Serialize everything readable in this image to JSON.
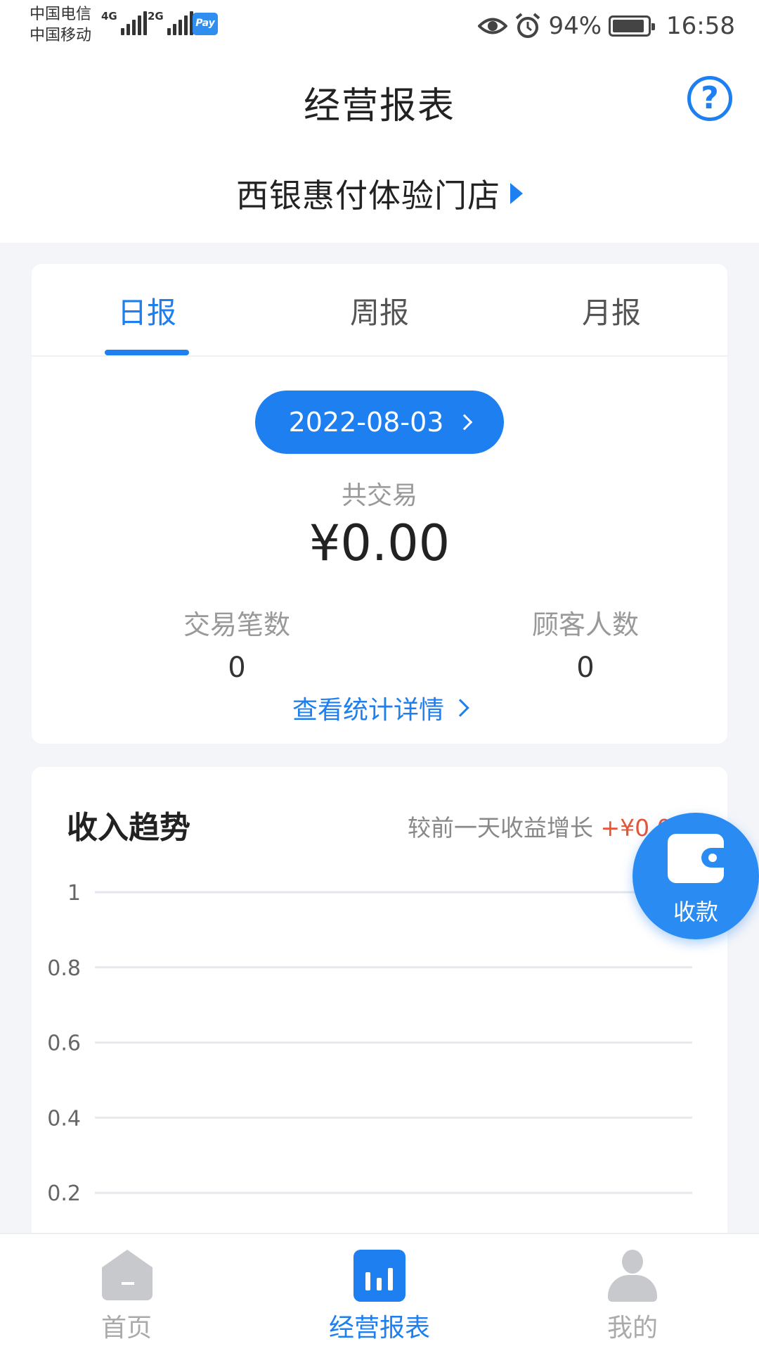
{
  "status_bar": {
    "carrier_1": "中国电信",
    "carrier_2": "中国移动",
    "net_1": "4G",
    "net_2": "2G",
    "pay_badge": "Pay",
    "battery": "94%",
    "time": "16:58"
  },
  "header": {
    "title": "经营报表",
    "help_symbol": "?",
    "store_name": "西银惠付体验门店"
  },
  "report": {
    "tabs": [
      {
        "label": "日报",
        "active": true
      },
      {
        "label": "周报",
        "active": false
      },
      {
        "label": "月报",
        "active": false
      }
    ],
    "date": "2022-08-03",
    "total_label": "共交易",
    "total_amount": "¥0.00",
    "stats": [
      {
        "label": "交易笔数",
        "value": "0"
      },
      {
        "label": "顾客人数",
        "value": "0"
      }
    ],
    "detail_link": "查看统计详情"
  },
  "trend": {
    "title": "收入趋势",
    "compare_text": "较前一天收益增长",
    "compare_value": "+¥0.0"
  },
  "chart_data": {
    "type": "line",
    "title": "收入趋势",
    "xlabel": "",
    "ylabel": "",
    "ylim": [
      0,
      1
    ],
    "y_ticks": [
      "1",
      "0.8",
      "0.6",
      "0.4",
      "0.2"
    ],
    "series": [],
    "grid": true
  },
  "fab": {
    "label": "收款",
    "icon": "wallet-icon"
  },
  "bottom_nav": [
    {
      "label": "首页",
      "icon": "home-icon",
      "active": false
    },
    {
      "label": "经营报表",
      "icon": "bar-chart-icon",
      "active": true
    },
    {
      "label": "我的",
      "icon": "person-icon",
      "active": false
    }
  ],
  "colors": {
    "accent": "#1e7ff0",
    "increase": "#e4553a",
    "background": "#f4f5f9"
  }
}
